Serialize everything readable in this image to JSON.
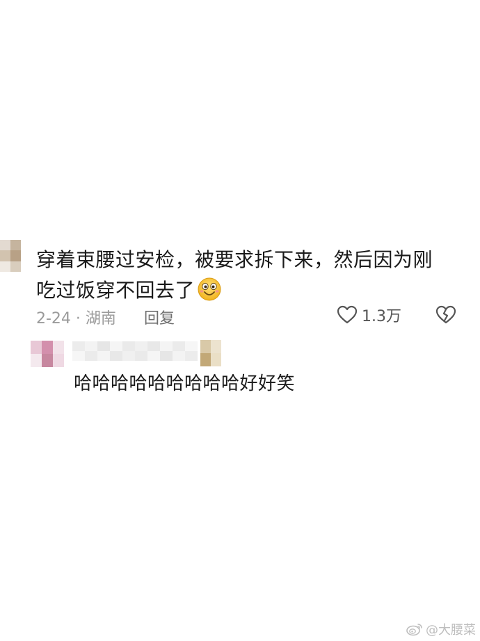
{
  "comment": {
    "text_line1": "穿着束腰过安检，被要求拆下来，然后因为刚",
    "text_line2": "吃过饭穿不回去了",
    "emoji": "grinning-face-emoji",
    "date_location": "2-24 · 湖南",
    "reply_label": "回复",
    "like_count": "1.3万",
    "avatar_colors": [
      "#e3dad1",
      "#c5b49e",
      "#d2c3af",
      "#b8a186",
      "#efe9e2",
      "#d9cdbd"
    ]
  },
  "reply": {
    "text": "哈哈哈哈哈哈哈哈哈好好笑",
    "avatar_colors": [
      "#e8c8d6",
      "#d38fac",
      "#f2e2e9",
      "#f4e9ee",
      "#c7879f",
      "#efd9e3"
    ],
    "name_colors": [
      "#ececec",
      "#f3f3f3",
      "#e6e6e6",
      "#f5f5f5",
      "#eaeaea",
      "#f0f0f0",
      "#e8e8e8",
      "#f4f4f4",
      "#ebebeb",
      "#f6f6f6"
    ],
    "badge_colors": [
      "#d9c9a8",
      "#ece3cf",
      "#c2a877",
      "#eadfc6"
    ]
  },
  "watermark": {
    "text": "@大腰菜",
    "icon": "weibo-icon"
  }
}
